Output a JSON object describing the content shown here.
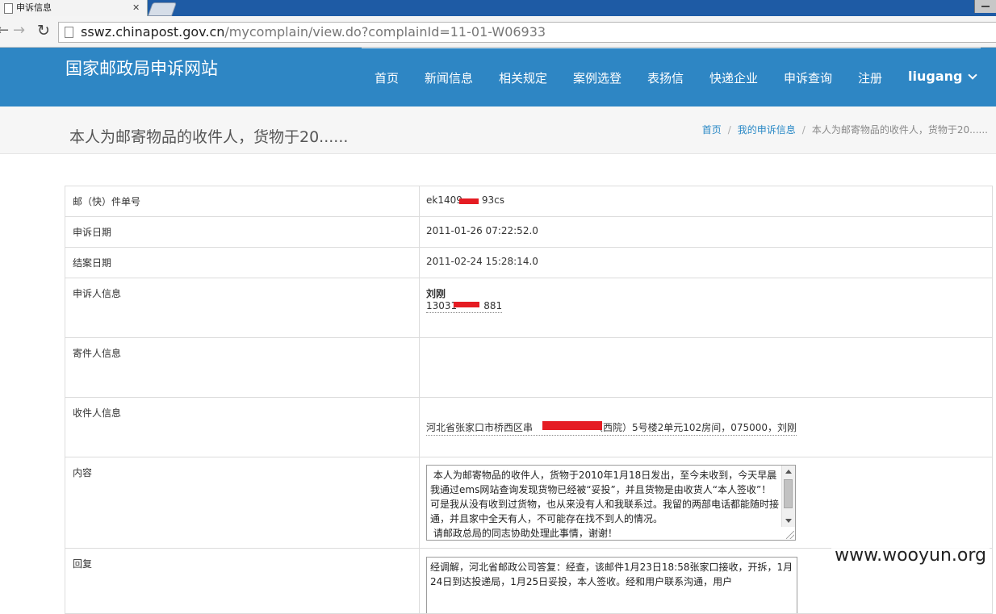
{
  "browser": {
    "tab_title": "申诉信息",
    "tab_close": "✕",
    "url_host": "sswz.chinapost.gov.cn",
    "url_path": "/mycomplain/view.do?complainId=11-01-W06933"
  },
  "site": {
    "brand": "国家邮政局申诉网站",
    "nav": [
      "首页",
      "新闻信息",
      "相关规定",
      "案例选登",
      "表扬信",
      "快递企业",
      "申诉查询",
      "注册"
    ],
    "user": "liugang"
  },
  "page": {
    "title": "本人为邮寄物品的收件人，货物于20......",
    "breadcrumb": {
      "home": "首页",
      "section": "我的申诉信息",
      "current": "本人为邮寄物品的收件人，货物于20......",
      "sep": "/"
    }
  },
  "details": {
    "tracking_label": "邮（快）件单号",
    "tracking_a": "ek1409",
    "tracking_b": "93cs",
    "complain_date_label": "申诉日期",
    "complain_date": "2011-01-26 07:22:52.0",
    "close_date_label": "结案日期",
    "close_date": "2011-02-24 15:28:14.0",
    "complainant_label": "申诉人信息",
    "complainant_name": "刘刚",
    "phone_a": "13031",
    "phone_b": "881",
    "sender_label": "寄件人信息",
    "receiver_label": "收件人信息",
    "receiver_a": "河北省张家口市桥西区串",
    "receiver_b": "（西院）5号楼2单元102房间，075000，刘刚",
    "content_label": "内容",
    "content": " 本人为邮寄物品的收件人，货物于2010年1月18日发出，至今未收到，今天早晨我通过ems网站查询发现货物已经被“妥投”，并且货物是由收货人“本人签收”！可是我从没有收到过货物，也从来没有人和我联系过。我留的两部电话都能随时接通，并且家中全天有人，不可能存在找不到人的情况。\n 请邮政总局的同志协助处理此事情，谢谢！",
    "reply_label": "回复",
    "reply": "经调解，河北省邮政公司答复：经查，该邮件1月23日18:58张家口接收，开拆，1月24日到达投递局，1月25日妥投，本人签收。经和用户联系沟通，用户"
  },
  "watermark": "www.wooyun.org",
  "colors": {
    "header": "#2e86c4",
    "link": "#2a89c6",
    "redaction": "#e51c23"
  }
}
